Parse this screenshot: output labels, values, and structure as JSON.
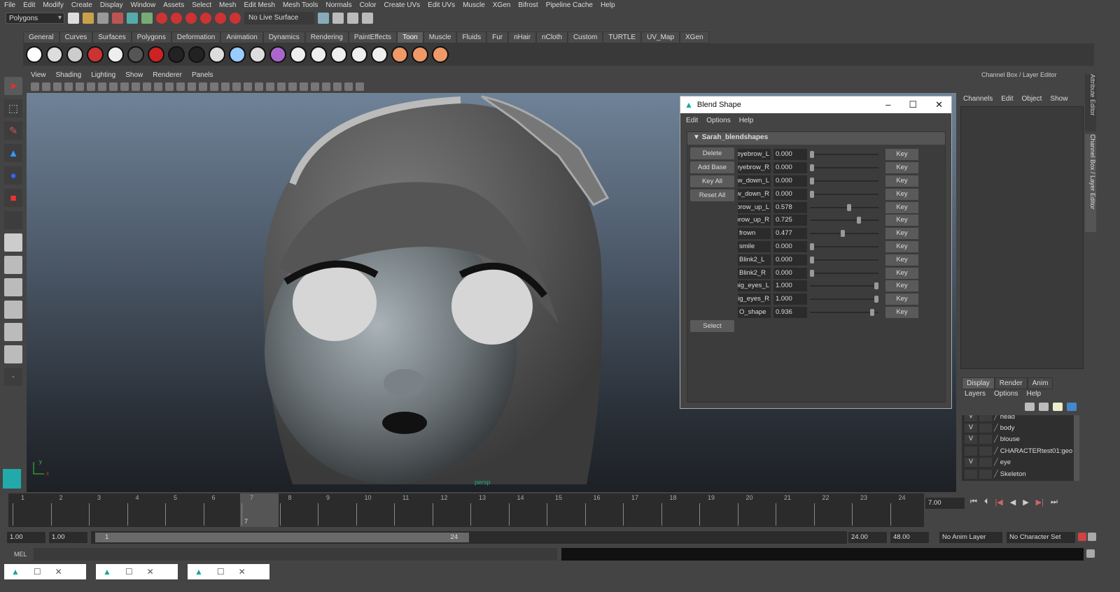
{
  "menubar": [
    "File",
    "Edit",
    "Modify",
    "Create",
    "Display",
    "Window",
    "Assets",
    "Select",
    "Mesh",
    "Edit Mesh",
    "Mesh Tools",
    "Normals",
    "Color",
    "Create UVs",
    "Edit UVs",
    "Muscle",
    "XGen",
    "Bifrost",
    "Pipeline Cache",
    "Help"
  ],
  "toolbar": {
    "mode": "Polygons",
    "live_surface": "No Live Surface"
  },
  "shelf_tabs": [
    "General",
    "Curves",
    "Surfaces",
    "Polygons",
    "Deformation",
    "Animation",
    "Dynamics",
    "Rendering",
    "PaintEffects",
    "Toon",
    "Muscle",
    "Fluids",
    "Fur",
    "nHair",
    "nCloth",
    "Custom",
    "TURTLE",
    "UV_Map",
    "XGen"
  ],
  "shelf_active": "Toon",
  "viewport_menu": [
    "View",
    "Shading",
    "Lighting",
    "Show",
    "Renderer",
    "Panels"
  ],
  "viewport": {
    "camera_label": "persp"
  },
  "blend_shape": {
    "title": "Blend Shape",
    "menu": [
      "Edit",
      "Options",
      "Help"
    ],
    "node": "Sarah_blendshapes",
    "buttons": [
      "Delete",
      "Add Base",
      "Key All",
      "Reset All"
    ],
    "select_label": "Select",
    "key_label": "Key",
    "targets": [
      {
        "name": "eyebrow_L",
        "value": 0.0
      },
      {
        "name": "eyebrow_R",
        "value": 0.0
      },
      {
        "name": "brow_down_L",
        "value": 0.0
      },
      {
        "name": "brow_down_R",
        "value": 0.0
      },
      {
        "name": "brow_up_L",
        "value": 0.578
      },
      {
        "name": "brow_up_R",
        "value": 0.725
      },
      {
        "name": "frown",
        "value": 0.477
      },
      {
        "name": "smile",
        "value": 0.0
      },
      {
        "name": "Blink2_L",
        "value": 0.0
      },
      {
        "name": "Blink2_R",
        "value": 0.0
      },
      {
        "name": "big_eyes_L",
        "value": 1.0
      },
      {
        "name": "big_eyes_R",
        "value": 1.0
      },
      {
        "name": "O_shape",
        "value": 0.936
      }
    ]
  },
  "right_panel": {
    "title": "Channel Box / Layer Editor",
    "menu": [
      "Channels",
      "Edit",
      "Object",
      "Show"
    ],
    "side_tabs": [
      "Attribute Editor",
      "Channel Box / Layer Editor"
    ],
    "layer_tabs": [
      "Display",
      "Render",
      "Anim"
    ],
    "layer_menu": [
      "Layers",
      "Options",
      "Help"
    ],
    "layers": [
      {
        "v": "V",
        "name": "head"
      },
      {
        "v": "V",
        "name": "body"
      },
      {
        "v": "V",
        "name": "blouse"
      },
      {
        "v": "",
        "name": "CHARACTERtest01:geo"
      },
      {
        "v": "V",
        "name": "eye"
      },
      {
        "v": "",
        "name": "Skeleton"
      }
    ]
  },
  "timeline": {
    "frames": [
      "1",
      "2",
      "3",
      "4",
      "5",
      "6",
      "7",
      "8",
      "9",
      "10",
      "11",
      "12",
      "13",
      "14",
      "15",
      "16",
      "17",
      "18",
      "19",
      "20",
      "21",
      "22",
      "23",
      "24"
    ],
    "current": "7",
    "current_field": "7.00"
  },
  "range": {
    "start": "1.00",
    "start2": "1.00",
    "slider_start": "1",
    "slider_end": "24",
    "end": "24.00",
    "end2": "48.00",
    "anim_layer": "No Anim Layer",
    "char_set": "No Character Set"
  },
  "command": {
    "label": "MEL"
  }
}
